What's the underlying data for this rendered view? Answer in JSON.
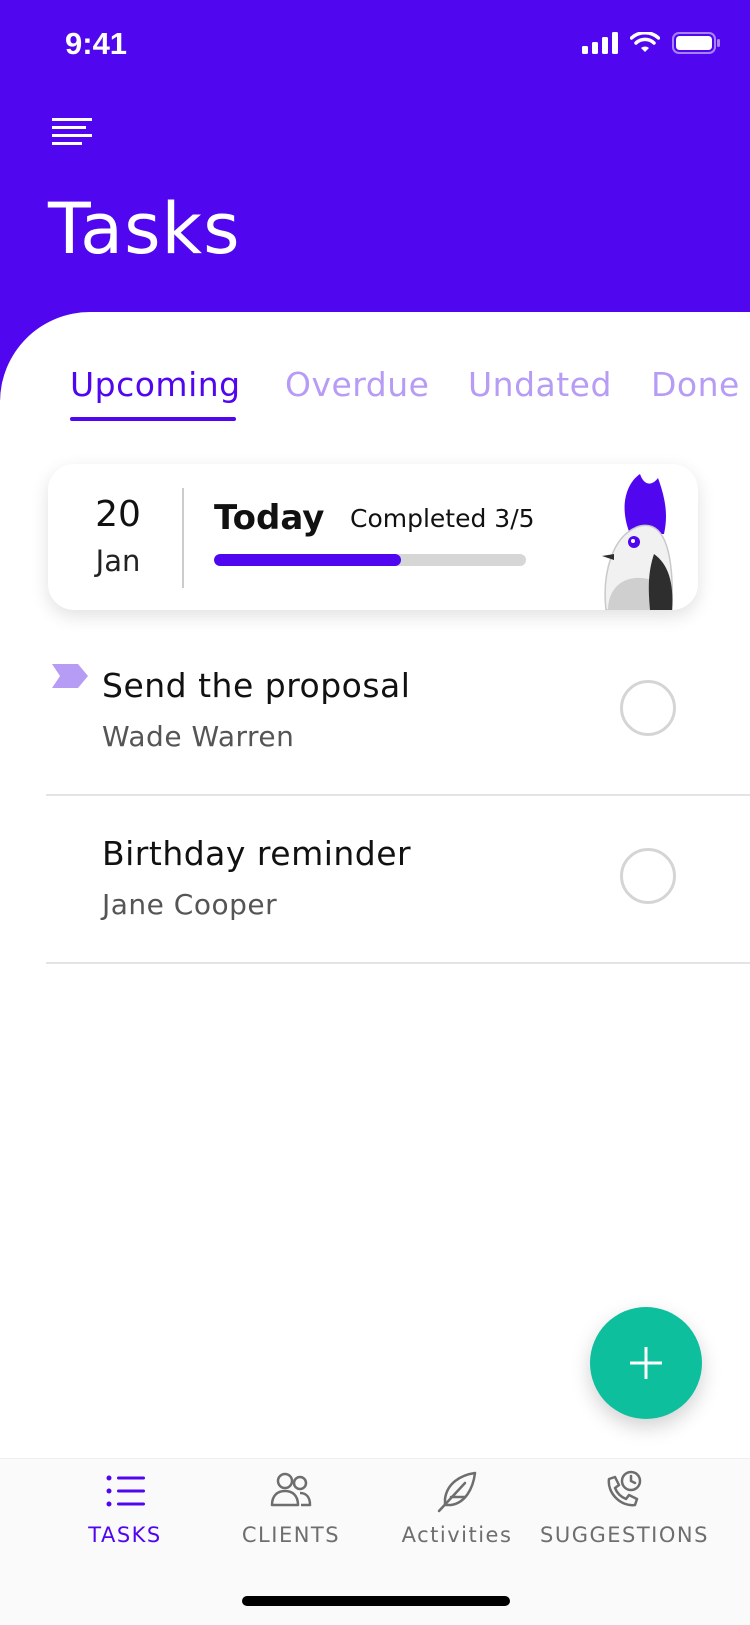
{
  "status_bar": {
    "time": "9:41"
  },
  "header": {
    "title": "Tasks"
  },
  "tabs": [
    {
      "label": "Upcoming",
      "active": true
    },
    {
      "label": "Overdue",
      "active": false
    },
    {
      "label": "Undated",
      "active": false
    },
    {
      "label": "Done",
      "active": false
    }
  ],
  "summary": {
    "day": "20",
    "month": "Jan",
    "today_label": "Today",
    "completed_label": "Completed 3/5",
    "progress": 0.6
  },
  "tasks": [
    {
      "title": "Send the proposal",
      "client": "Wade Warren",
      "flagged": true,
      "done": false
    },
    {
      "title": "Birthday reminder",
      "client": "Jane Cooper",
      "flagged": false,
      "done": false
    }
  ],
  "bottom_nav": [
    {
      "label": "TASKS",
      "icon": "list-icon",
      "active": true
    },
    {
      "label": "CLIENTS",
      "icon": "users-icon",
      "active": false
    },
    {
      "label": "Activities",
      "icon": "feather-icon",
      "active": false
    },
    {
      "label": "SUGGESTIONS",
      "icon": "phone-clock-icon",
      "active": false
    }
  ],
  "colors": {
    "primary": "#5106F0",
    "tab_inactive": "#B79CF6",
    "fab": "#0DBF9D",
    "flag": "#B79CF6"
  }
}
